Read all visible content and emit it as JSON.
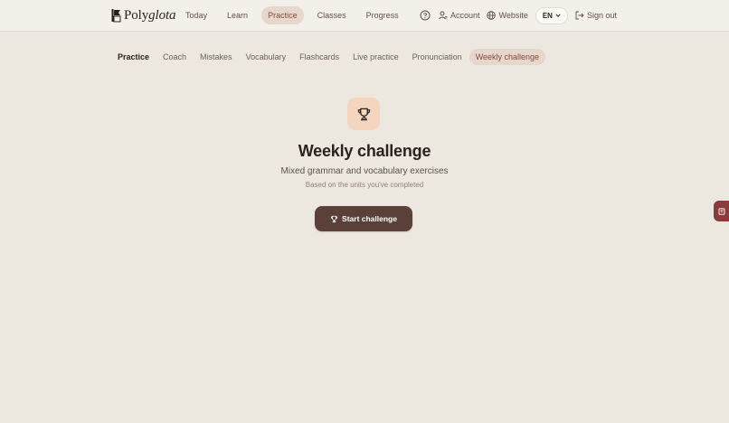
{
  "brand": {
    "name_plain": "Poly",
    "name_italic": "glota",
    "logo_icon": "book-flag-icon"
  },
  "main_nav": {
    "items": [
      {
        "label": "Today"
      },
      {
        "label": "Learn"
      },
      {
        "label": "Practice",
        "active": true
      },
      {
        "label": "Classes"
      },
      {
        "label": "Progress"
      }
    ]
  },
  "tools": {
    "help_icon": "help-circle-icon",
    "account_label": "Account",
    "website_label": "Website",
    "language": "EN",
    "signout_label": "Sign out"
  },
  "sub_nav": {
    "items": [
      {
        "label": "Practice"
      },
      {
        "label": "Coach"
      },
      {
        "label": "Mistakes"
      },
      {
        "label": "Vocabulary"
      },
      {
        "label": "Flashcards"
      },
      {
        "label": "Live practice"
      },
      {
        "label": "Pronunciation"
      },
      {
        "label": "Weekly challenge",
        "active": true
      }
    ]
  },
  "challenge": {
    "title": "Weekly challenge",
    "subtitle": "Mixed grammar and vocabulary exercises",
    "caption": "Based on the units you've completed",
    "start_label": "Start challenge",
    "icon": "trophy-icon"
  },
  "side_tab": {
    "icon": "notebook-icon"
  },
  "colors": {
    "background": "#ede8df",
    "accent": "#8a4a3a",
    "button": "#5a4038",
    "tile": "#f4d5bd",
    "side_tab": "#8a3a3a"
  }
}
